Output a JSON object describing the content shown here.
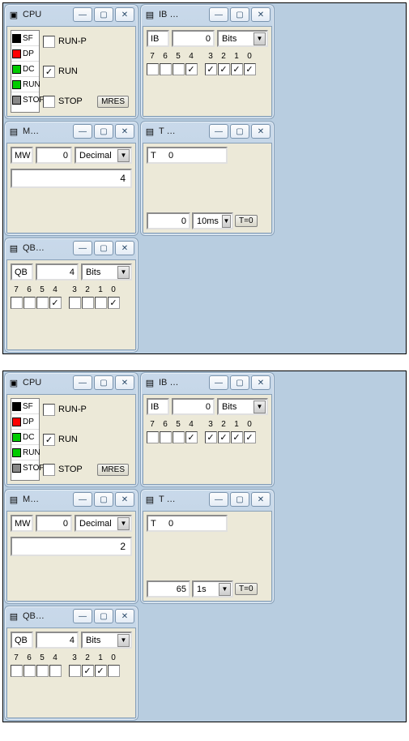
{
  "snapshots": [
    {
      "cpu": {
        "title": "CPU",
        "leds": [
          {
            "name": "SF",
            "color": "#000"
          },
          {
            "name": "DP",
            "color": "#f00"
          },
          {
            "name": "DC",
            "color": "#0c0"
          },
          {
            "name": "RUN",
            "color": "#0c0"
          },
          {
            "name": "STOP",
            "color": "#888"
          }
        ],
        "opts": {
          "runp": "RUN-P",
          "run": "RUN",
          "stop": "STOP",
          "run_checked": true
        },
        "mres": "MRES"
      },
      "ib": {
        "title": "IB  …",
        "label": "IB",
        "value": "0",
        "fmt": "Bits",
        "bits": [
          "7",
          "6",
          "5",
          "4",
          "3",
          "2",
          "1",
          "0"
        ],
        "checked": [
          false,
          false,
          false,
          true,
          true,
          true,
          true,
          true
        ]
      },
      "mw": {
        "title": "M…",
        "label": "MW",
        "value": "0",
        "fmt": "Decimal",
        "display": "4"
      },
      "t": {
        "title": "T  …",
        "label": "T",
        "value": "0",
        "num": "0",
        "unit": "10ms",
        "btn": "T=0"
      },
      "qb": {
        "title": "QB…",
        "label": "QB",
        "value": "4",
        "fmt": "Bits",
        "bits": [
          "7",
          "6",
          "5",
          "4",
          "3",
          "2",
          "1",
          "0"
        ],
        "checked": [
          false,
          false,
          false,
          true,
          false,
          false,
          false,
          true
        ]
      }
    },
    {
      "cpu": {
        "title": "CPU",
        "leds": [
          {
            "name": "SF",
            "color": "#000"
          },
          {
            "name": "DP",
            "color": "#f00"
          },
          {
            "name": "DC",
            "color": "#0c0"
          },
          {
            "name": "RUN",
            "color": "#0c0"
          },
          {
            "name": "STOP",
            "color": "#888"
          }
        ],
        "opts": {
          "runp": "RUN-P",
          "run": "RUN",
          "stop": "STOP",
          "run_checked": true
        },
        "mres": "MRES"
      },
      "ib": {
        "title": "IB  …",
        "label": "IB",
        "value": "0",
        "fmt": "Bits",
        "bits": [
          "7",
          "6",
          "5",
          "4",
          "3",
          "2",
          "1",
          "0"
        ],
        "checked": [
          false,
          false,
          false,
          true,
          true,
          true,
          true,
          true
        ]
      },
      "mw": {
        "title": "M…",
        "label": "MW",
        "value": "0",
        "fmt": "Decimal",
        "display": "2"
      },
      "t": {
        "title": "T  …",
        "label": "T",
        "value": "0",
        "num": "65",
        "unit": "1s",
        "btn": "T=0"
      },
      "qb": {
        "title": "QB…",
        "label": "QB",
        "value": "4",
        "fmt": "Bits",
        "bits": [
          "7",
          "6",
          "5",
          "4",
          "3",
          "2",
          "1",
          "0"
        ],
        "checked": [
          false,
          false,
          false,
          false,
          false,
          true,
          true,
          false
        ]
      }
    }
  ],
  "icons": {
    "cpu": "▣",
    "var": "▤"
  },
  "winbtns": {
    "min": "—",
    "max": "▢",
    "close": "✕"
  }
}
